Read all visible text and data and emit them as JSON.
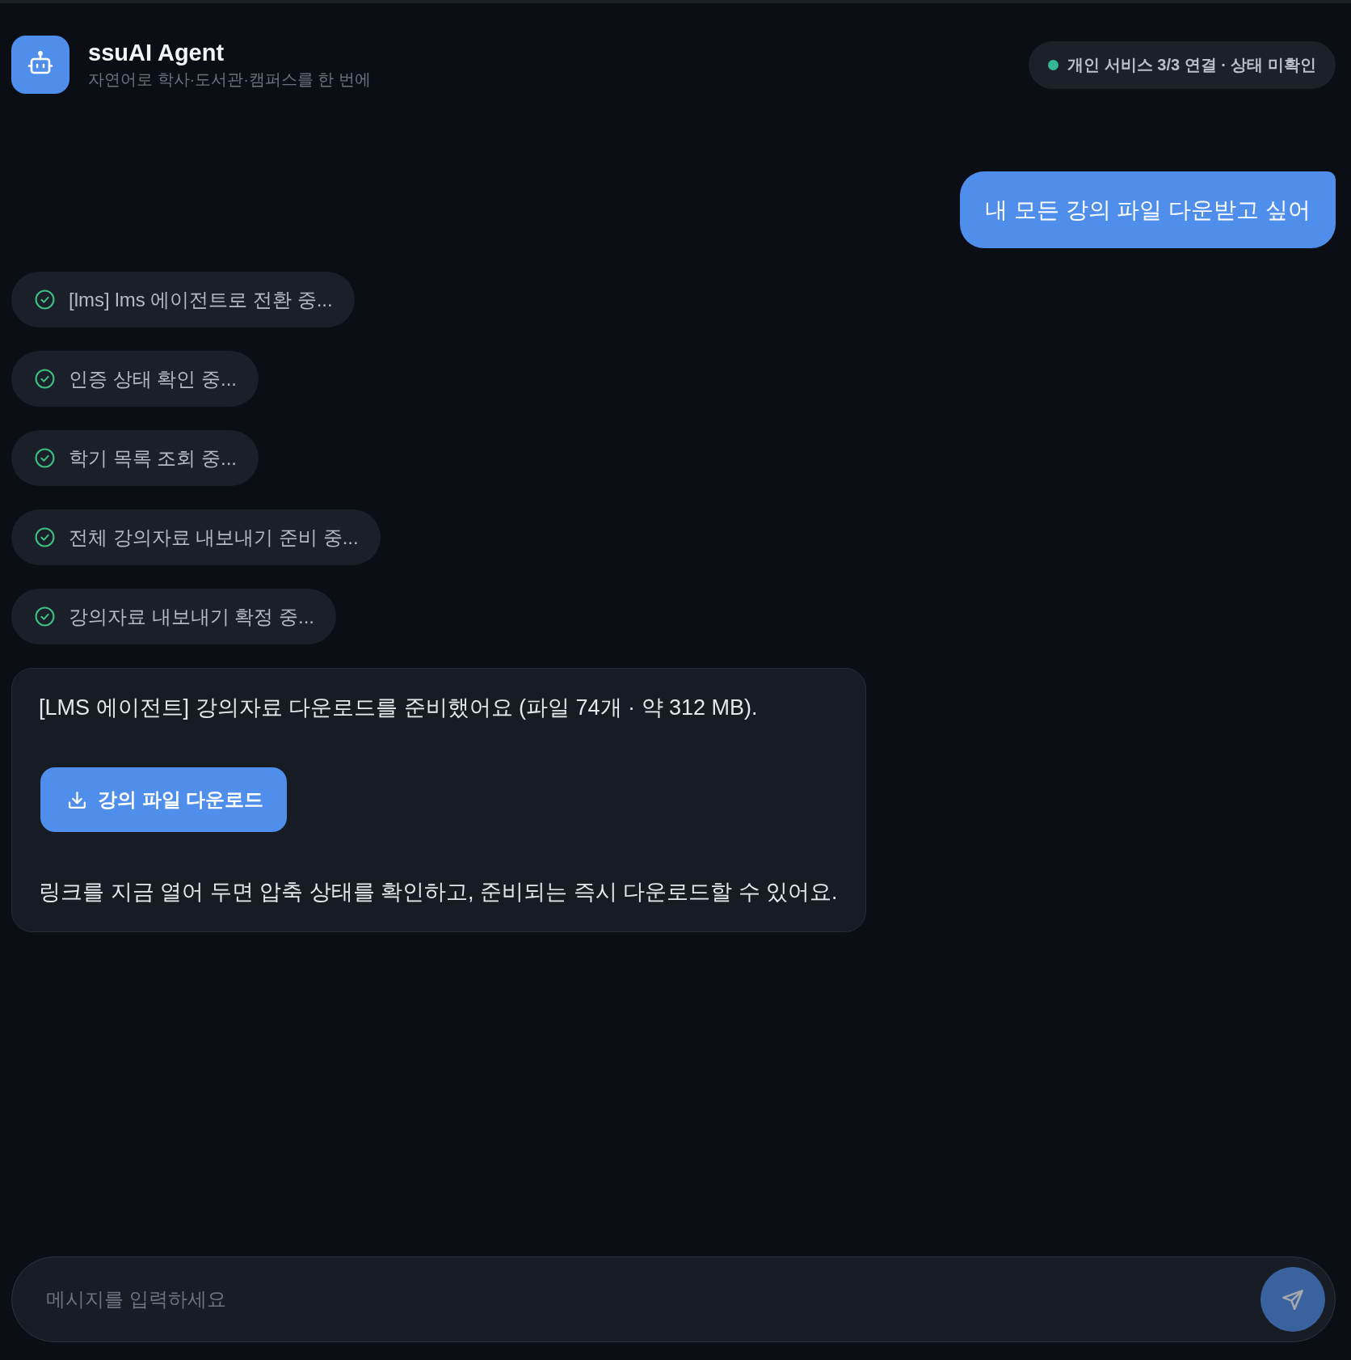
{
  "header": {
    "title": "ssuAI Agent",
    "subtitle": "자연어로 학사·도서관·캠퍼스를 한 번에",
    "status": {
      "label": "개인 서비스 3/3 연결 · 상태 미확인",
      "online": true
    }
  },
  "messages": [
    {
      "kind": "user",
      "text": "내 모든 강의 파일 다운받고 싶어"
    },
    {
      "kind": "step",
      "text": "[lms] lms 에이전트로 전환 중...",
      "done": true
    },
    {
      "kind": "step",
      "text": "인증 상태 확인 중...",
      "done": true
    },
    {
      "kind": "step",
      "text": "학기 목록 조회 중...",
      "done": true
    },
    {
      "kind": "step",
      "text": "전체 강의자료 내보내기 준비 중...",
      "done": true
    },
    {
      "kind": "step",
      "text": "강의자료 내보내기 확정 중...",
      "done": true
    },
    {
      "kind": "assistant",
      "blocks": [
        {
          "kind": "text",
          "text": "[LMS 에이전트] 강의자료 다운로드를 준비했어요 (파일 74개 · 약 312 MB)."
        },
        {
          "kind": "button",
          "label": "강의 파일 다운로드"
        },
        {
          "kind": "text",
          "text": "링크를 지금 열어 두면 압축 상태를 확인하고, 준비되는 즉시 다운로드할 수 있어요."
        }
      ]
    }
  ],
  "composer": {
    "placeholder": "메시지를 입력하세요",
    "send_disabled": true
  }
}
